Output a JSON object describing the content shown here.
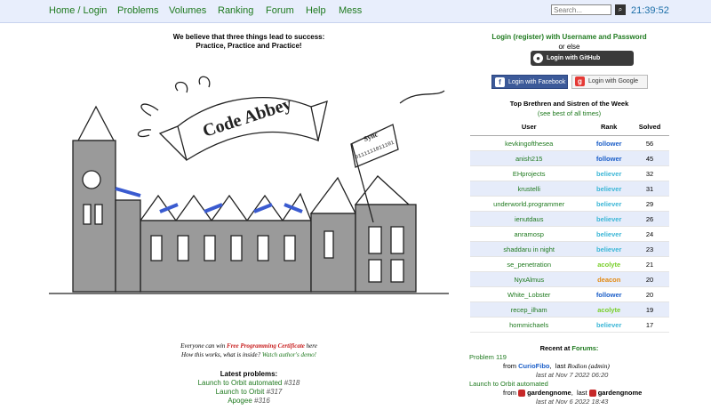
{
  "nav": {
    "items": [
      "Home / Login",
      "Problems",
      "Volumes",
      "Ranking",
      "Forum",
      "Help",
      "Mess"
    ],
    "search_placeholder": "Search...",
    "search_button": "⌕",
    "clock": "21:39:52"
  },
  "tagline": [
    "We believe that three things lead to success:",
    "Practice, Practice and Practice!"
  ],
  "art": {
    "banner": "Code Abbey",
    "flag_title": "Sync",
    "flag_code": "0111111011101"
  },
  "certificate": {
    "pre": "Everyone can win ",
    "link": "Free Programming Certificate",
    "post": " here",
    "line2_pre": "How this works, what is inside? ",
    "demo_link": "Watch author's demo!"
  },
  "latest": {
    "heading": "Latest problems:",
    "items": [
      {
        "name": "Launch to Orbit automated",
        "num": "#318"
      },
      {
        "name": "Launch to Orbit",
        "num": "#317"
      },
      {
        "name": "Apogee",
        "num": "#316"
      }
    ]
  },
  "login": {
    "line": "Login (register) with Username and Password",
    "or": "or else",
    "github": "Login with GitHub",
    "facebook": "Login with Facebook",
    "google": "Login with Google"
  },
  "top": {
    "title": "Top Brethren and Sistren of the Week",
    "link": "(see best of all times)",
    "headers": [
      "User",
      "Rank",
      "Solved"
    ],
    "rows": [
      {
        "user": "kevkingofthesea",
        "rank": "follower",
        "solved": "56"
      },
      {
        "user": "anish215",
        "rank": "follower",
        "solved": "45"
      },
      {
        "user": "EHprojects",
        "rank": "believer",
        "solved": "32"
      },
      {
        "user": "krustelli",
        "rank": "believer",
        "solved": "31"
      },
      {
        "user": "underworld.programmer",
        "rank": "believer",
        "solved": "29"
      },
      {
        "user": "ienutdaus",
        "rank": "believer",
        "solved": "26"
      },
      {
        "user": "anramosp",
        "rank": "believer",
        "solved": "24"
      },
      {
        "user": "shaddaru in night",
        "rank": "believer",
        "solved": "23"
      },
      {
        "user": "se_penetration",
        "rank": "acolyte",
        "solved": "21"
      },
      {
        "user": "NyxAlmus",
        "rank": "deacon",
        "solved": "20"
      },
      {
        "user": "White_Lobster",
        "rank": "follower",
        "solved": "20"
      },
      {
        "user": "recep_ilham",
        "rank": "acolyte",
        "solved": "19"
      },
      {
        "user": "hommichaels",
        "rank": "believer",
        "solved": "17"
      }
    ]
  },
  "recent": {
    "heading_pre": "Recent at ",
    "heading_link": "Forums:",
    "topics": [
      {
        "title": "Problem 119",
        "from_label": "from",
        "from": "CurioFibo",
        "last_label": "last",
        "last": "Rodion (admin)",
        "date": "last at Nov 7 2022 06:20"
      },
      {
        "title": "Launch to Orbit automated",
        "from_label": "from",
        "from": "gardengnome",
        "last_label": "last",
        "last": "gardengnome",
        "date": "last at Nov 6 2022 18:43"
      }
    ]
  }
}
